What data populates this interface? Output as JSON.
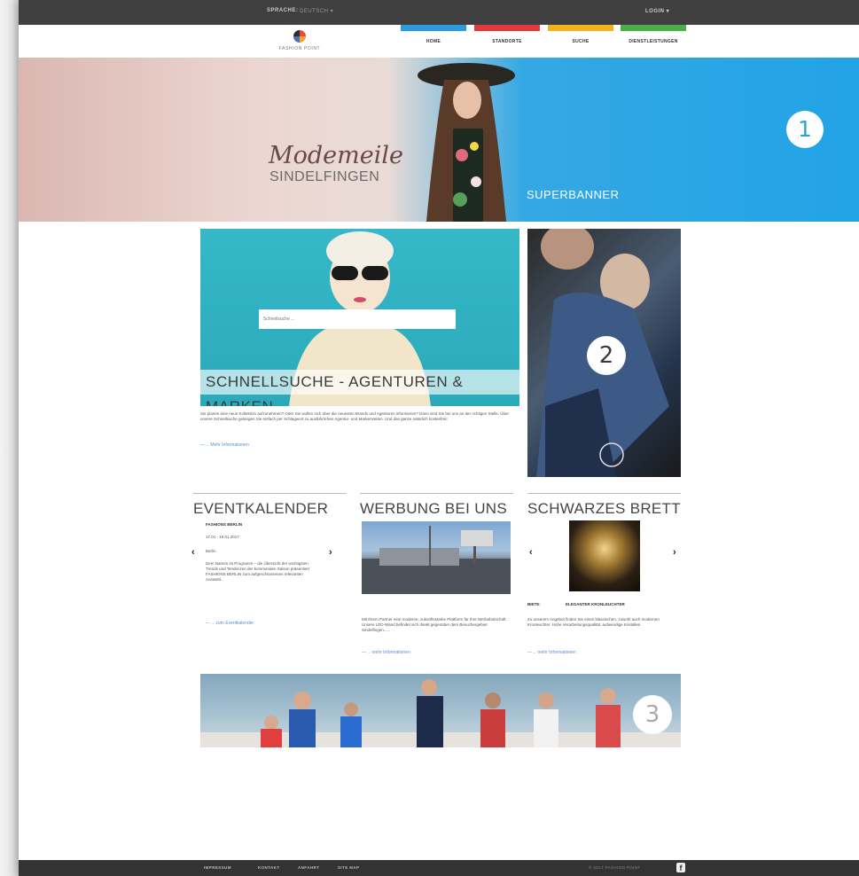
{
  "topbar": {
    "language_label": "SPRACHE:",
    "language_value": "DEUTSCH ▾",
    "login": "LOGIN ▾"
  },
  "header": {
    "logo_text": "FASHION POINT"
  },
  "nav": [
    {
      "label": "HOME",
      "color": "#2b9be0"
    },
    {
      "label": "STANDORTE",
      "color": "#e23a3a"
    },
    {
      "label": "SUCHE",
      "color": "#f4b21d"
    },
    {
      "label": "DIENSTLEISTUNGEN",
      "color": "#49ae45"
    }
  ],
  "banner": {
    "script": "Modemeile",
    "subtitle": "SINDELFINGEN",
    "label": "SUPERBANNER",
    "marker": "1"
  },
  "search": {
    "placeholder": "Schnellsuche ...",
    "title": "SCHNELLSUCHE - AGENTUREN & MARKEN",
    "intro": "Sie planen eine neue Kollektion aufzunehmen? Oder Sie wollen sich über die neuesten Brands und Agenturen informieren? Dann sind Sie bei uns an der richtigen Stelle. Über unsere Schnellsuche gelangen Sie einfach per Schlagwort zu ausführlichen Agentur- und Markenseiten. Und das ganze natürlich kostenfrei!",
    "more": "—→ Mehr Informationen"
  },
  "side_ad": {
    "marker": "2"
  },
  "events": {
    "title": "EVENTKALENDER",
    "event_name": "FASHIONS BERLIN",
    "date": "17.01 - 19.01.2017",
    "city": "Berlin",
    "text": "Dem Namen ist Programm – die Übersicht der wichtigsten Trends und Tendenzen der kommenden Saison präsentiert FASHIONS BERLIN zum aufgeschlossenen relevanten Auswahl...",
    "more": "—→ zum Eventkalender",
    "prev": "‹",
    "next": "›"
  },
  "advert": {
    "title": "WERBUNG BEI UNS",
    "text": "Mit Ihrem Partner eine moderne, zukunftsstarke Plattform für Ihre Werbebotschaft. Unsere LED-Wand befindet sich direkt gegenüber dem Besuchergebiet Sindelfingen......",
    "more": "—→ mehr Informationen"
  },
  "board": {
    "title": "SCHWARZES BRETT",
    "label_left": "BIETE:",
    "label_right": "ELEGANTER KRONLEUCHTER",
    "text": "Zu unserem Angebot finden Sie einen klassischen, zuwohl auch modernen Kronleuchter. Hohe Verarbeitungsqualität, aufwendige Kristallen.",
    "more": "—→ mehr Informationen",
    "prev": "‹",
    "next": "›"
  },
  "bottom_ad": {
    "marker": "3"
  },
  "footer": {
    "links": [
      "IMPRESSUM",
      "KONTAKT",
      "ANFAHRT",
      "SITE MAP"
    ],
    "copyright": "© 2017 FASHION POINT",
    "social": "f"
  }
}
